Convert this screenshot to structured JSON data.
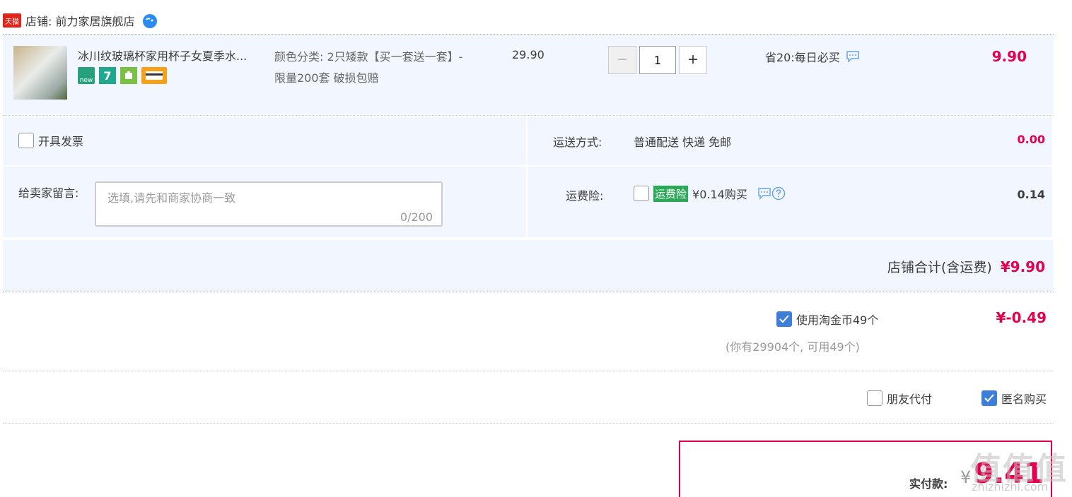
{
  "shop": {
    "badge": "天猫",
    "label": "店铺: 前力家居旗舰店"
  },
  "item": {
    "title": "冰川纹玻璃杯家用杯子女夏季水...",
    "icon_new": "new",
    "icon_seven": "7",
    "sku": "颜色分类: 2只矮款【买一套送一套】-限量200套 破损包赔",
    "price": "29.90",
    "qty_minus": "−",
    "qty_value": "1",
    "qty_plus": "+",
    "promo": "省20:每日必买",
    "subtotal": "9.90"
  },
  "options": {
    "invoice_label": "开具发票",
    "memo_label": "给卖家留言:",
    "memo_placeholder": "选填,请先和商家协商一致",
    "memo_count": "0/200",
    "shipping_label": "运送方式:",
    "shipping_value": "普通配送 快递 免邮",
    "shipping_price": "0.00",
    "insurance_label": "运费险:",
    "insurance_tag": "运费险",
    "insurance_text": "¥0.14购买",
    "insurance_price": "0.14"
  },
  "shop_total": {
    "label": "店铺合计(含运费)",
    "amount": "¥9.90"
  },
  "coins": {
    "label": "使用淘金币49个",
    "checked": true,
    "amount": "¥-0.49",
    "sub": "(你有29904个, 可用49个)"
  },
  "friend_pay": {
    "label": "朋友代付",
    "checked": false
  },
  "anonymous": {
    "label": "匿名购买",
    "checked": true
  },
  "pay": {
    "label": "实付款:",
    "yen": "¥",
    "amount": "9.41"
  },
  "watermark": {
    "text": "值值值",
    "url": "zhizhizhi.com"
  },
  "colors": {
    "price_red": "#e5004f",
    "panel_bg": "#f2f7ff",
    "check_blue": "#3d7fd8",
    "insurance_green": "#2aaa56"
  }
}
